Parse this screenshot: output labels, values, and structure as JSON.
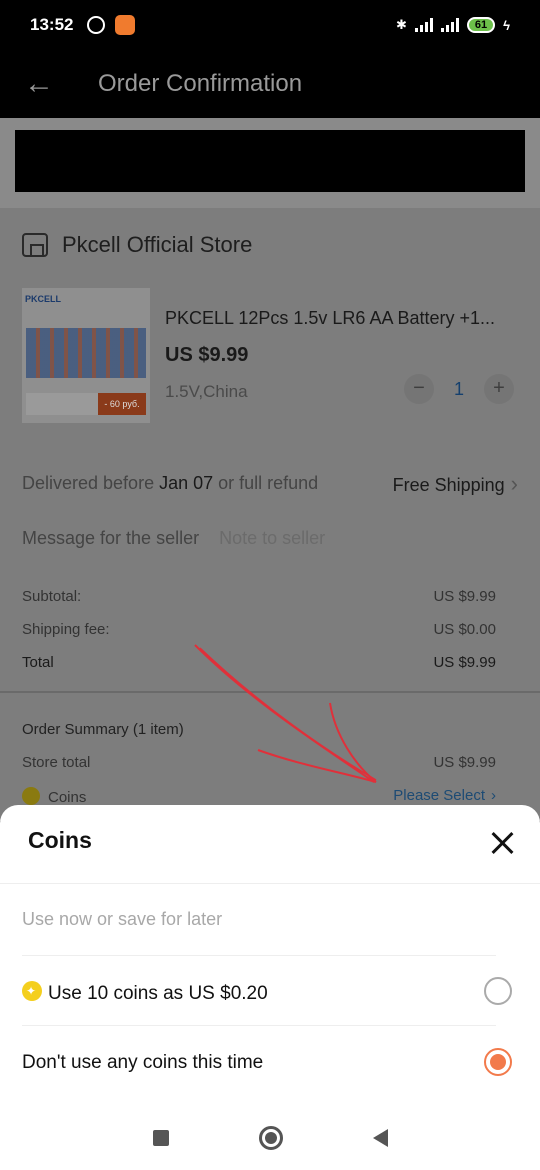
{
  "status_bar": {
    "time": "13:52",
    "battery": "61"
  },
  "header": {
    "title": "Order Confirmation"
  },
  "store": {
    "name": "Pkcell Official Store"
  },
  "product": {
    "logo": "PKCELL",
    "promo": "- 60 руб.",
    "title": "PKCELL 12Pcs 1.5v LR6 AA Battery +1...",
    "price": "US $9.99",
    "variant": "1.5V,China",
    "quantity": "1"
  },
  "delivery": {
    "prefix": "Delivered before ",
    "date": "Jan 07",
    "suffix": " or full refund",
    "shipping": "Free Shipping"
  },
  "message": {
    "label": "Message for the seller",
    "placeholder": "Note to seller"
  },
  "totals": {
    "subtotal_label": "Subtotal:",
    "subtotal": "US $9.99",
    "shipping_label": "Shipping fee:",
    "shipping": "US $0.00",
    "total_label": "Total",
    "total": "US $9.99"
  },
  "order_summary": {
    "title": "Order Summary (1 item)",
    "store_total_label": "Store total",
    "store_total": "US $9.99",
    "coins_label": "Coins",
    "coins_action": "Please Select"
  },
  "sheet": {
    "title": "Coins",
    "hint": "Use now or save for later",
    "options": [
      {
        "label": "Use 10 coins as US $0.20",
        "selected": false
      },
      {
        "label": "Don't use any coins this time",
        "selected": true
      }
    ]
  },
  "colors": {
    "accent": "#f27a4b",
    "coin": "#f4cf1e",
    "annotation": "#e0303a"
  }
}
